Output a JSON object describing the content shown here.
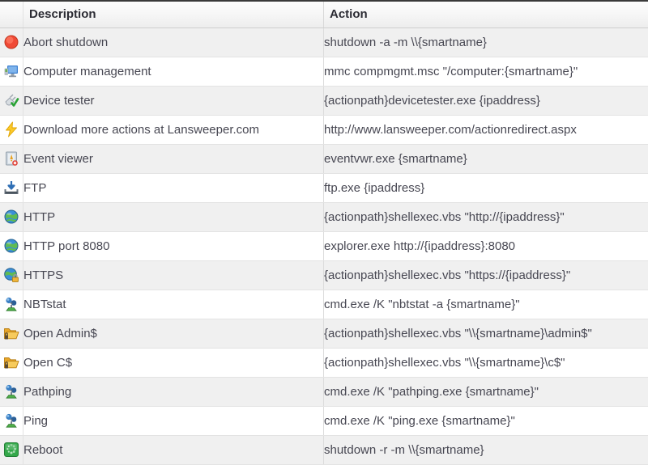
{
  "table": {
    "columns": [
      {
        "key": "icon",
        "label": ""
      },
      {
        "key": "description",
        "label": "Description"
      },
      {
        "key": "action",
        "label": "Action"
      }
    ],
    "headers": {
      "icon": "",
      "description": "Description",
      "action": "Action"
    },
    "rows": [
      {
        "icon": "red-circle-abort-icon",
        "description": "Abort shutdown",
        "action": "shutdown -a -m \\\\{smartname}"
      },
      {
        "icon": "computer-monitor-icon",
        "description": "Computer management",
        "action": "mmc compmgmt.msc \"/computer:{smartname}\""
      },
      {
        "icon": "plug-checkmark-icon",
        "description": "Device tester",
        "action": "{actionpath}devicetester.exe {ipaddress}"
      },
      {
        "icon": "lightning-bolt-icon",
        "description": "Download more actions at Lansweeper.com",
        "action": "http://www.lansweeper.com/actionredirect.aspx"
      },
      {
        "icon": "event-log-book-icon",
        "description": "Event viewer",
        "action": "eventvwr.exe {smartname}"
      },
      {
        "icon": "download-tray-icon",
        "description": "FTP",
        "action": "ftp.exe {ipaddress}"
      },
      {
        "icon": "globe-icon",
        "description": "HTTP",
        "action": "{actionpath}shellexec.vbs \"http://{ipaddress}\""
      },
      {
        "icon": "globe-icon",
        "description": "HTTP port 8080",
        "action": "explorer.exe http://{ipaddress}:8080"
      },
      {
        "icon": "globe-lock-icon",
        "description": "HTTPS",
        "action": "{actionpath}shellexec.vbs \"https://{ipaddress}\""
      },
      {
        "icon": "network-node-icon",
        "description": "NBTstat",
        "action": "cmd.exe /K \"nbtstat -a {smartname}\""
      },
      {
        "icon": "open-folder-icon",
        "description": "Open Admin$",
        "action": "{actionpath}shellexec.vbs \"\\\\{smartname}\\admin$\""
      },
      {
        "icon": "open-folder-icon",
        "description": "Open C$",
        "action": "{actionpath}shellexec.vbs \"\\\\{smartname}\\c$\""
      },
      {
        "icon": "network-node-icon",
        "description": "Pathping",
        "action": "cmd.exe /K \"pathping.exe {smartname}\""
      },
      {
        "icon": "network-node-icon",
        "description": "Ping",
        "action": "cmd.exe /K \"ping.exe {smartname}\""
      },
      {
        "icon": "green-reboot-icon",
        "description": "Reboot",
        "action": "shutdown -r -m \\\\{smartname}"
      }
    ]
  },
  "colors": {
    "header_text": "#2b2b33",
    "row_text": "#474752",
    "stripe": "#f0f0f0",
    "row_alt": "#ffffff",
    "grid_line": "#e3e3e3",
    "top_border": "#3a3a3a"
  }
}
